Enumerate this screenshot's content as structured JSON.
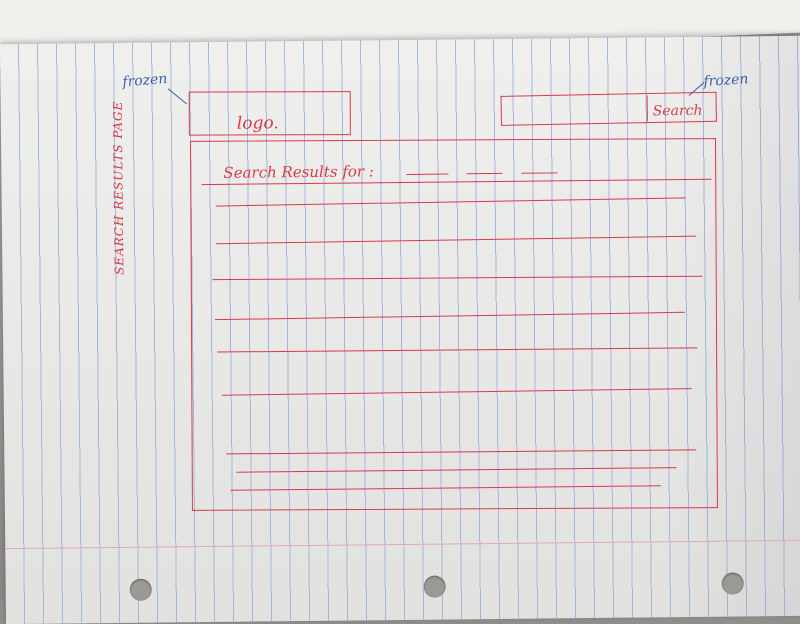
{
  "sketch": {
    "page_label": "SEARCH RESULTS PAGE",
    "logo_label": "logo.",
    "search_button_label": "Search",
    "frozen_note_left": "frozen",
    "frozen_note_right": "frozen",
    "results_heading": "Search Results for :",
    "result_row_count": 9
  },
  "colors": {
    "red_ink": "#d83a48",
    "blue_ink": "#3a5fa8",
    "paper": "#f4f5f3",
    "rule_lines": "#9fb9dd"
  }
}
